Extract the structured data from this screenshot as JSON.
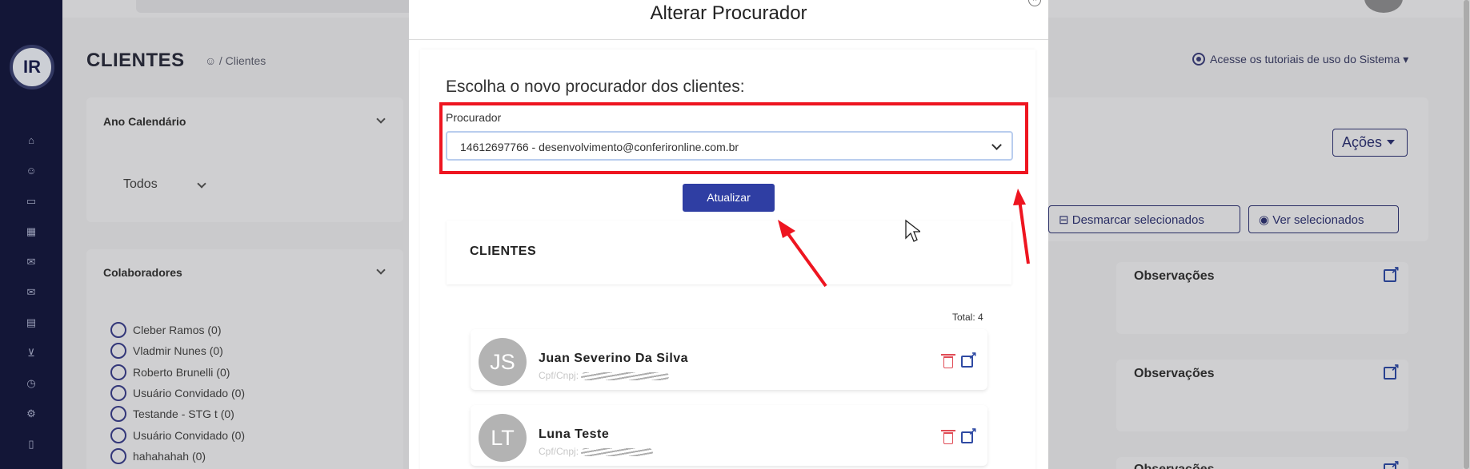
{
  "page": {
    "title": "CLIENTES",
    "breadcrumb_sep": "/",
    "breadcrumb_current": "Clientes",
    "tutorials": "Acesse os tutoriais de uso do Sistema",
    "actions_label": "Ações",
    "unmark_label": "Desmarcar selecionados",
    "view_selected_label": "Ver selecionados",
    "observations_label": "Observações"
  },
  "sidebar": {
    "logo_text": "IR",
    "icons": [
      "home-icon",
      "users-icon",
      "card-icon",
      "buildings-icon",
      "mail-icon",
      "mail-open-icon",
      "calculator-icon",
      "inbox-download-icon",
      "clock-icon",
      "user-cog-icon",
      "file-icon"
    ]
  },
  "filters": {
    "year_title": "Ano Calendário",
    "year_value": "Todos",
    "collab_title": "Colaboradores",
    "collaborators": [
      "Cleber Ramos (0)",
      "Vladmir Nunes (0)",
      "Roberto Brunelli (0)",
      "Usuário Convidado (0)",
      "Testande - STG t (0)",
      "Usuário Convidado (0)",
      "hahahahah (0)"
    ]
  },
  "modal": {
    "title": "Alterar Procurador",
    "prompt": "Escolha o novo procurador dos clientes:",
    "field_label": "Procurador",
    "selected_value": "14612697766 - desenvolvimento@conferironline.com.br",
    "submit_label": "Atualizar",
    "clients_title": "CLIENTES",
    "total_label": "Total: 4",
    "clients": [
      {
        "initials": "JS",
        "name": "Juan Severino Da Silva",
        "doc_label": "Cpf/Cnpj:"
      },
      {
        "initials": "LT",
        "name": "Luna Teste",
        "doc_label": "Cpf/Cnpj:"
      }
    ]
  },
  "colors": {
    "sidebar": "#161a3f",
    "primary": "#2f3ea3",
    "highlight": "#ee1520",
    "delete": "#e04b55"
  }
}
